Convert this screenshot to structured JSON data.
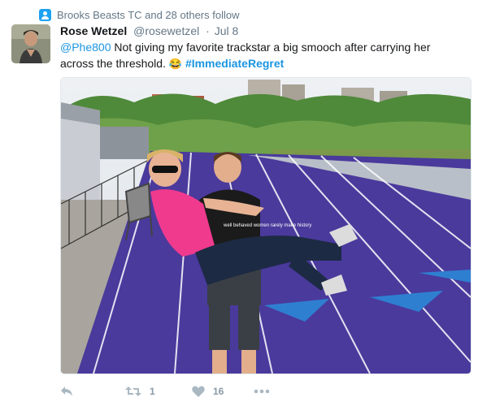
{
  "social_context": {
    "text": "Brooks Beasts TC and 28 others follow"
  },
  "tweet": {
    "display_name": "Rose Wetzel",
    "handle": "@rosewetzel",
    "separator": "·",
    "date": "Jul 8",
    "mention": "@Phe800",
    "text_line": "Not giving my favorite trackstar a big smooch after carrying her across the threshold.",
    "emoji": "😂",
    "hashtag": "#ImmediateRegret",
    "shirt_text": "well behaved women rarely make history"
  },
  "actions": {
    "retweet_count": "1",
    "like_count": "16"
  },
  "colors": {
    "link": "#1b95e0",
    "muted": "#657786",
    "icon": "#aab8c2",
    "track": "#4a3a9c"
  }
}
